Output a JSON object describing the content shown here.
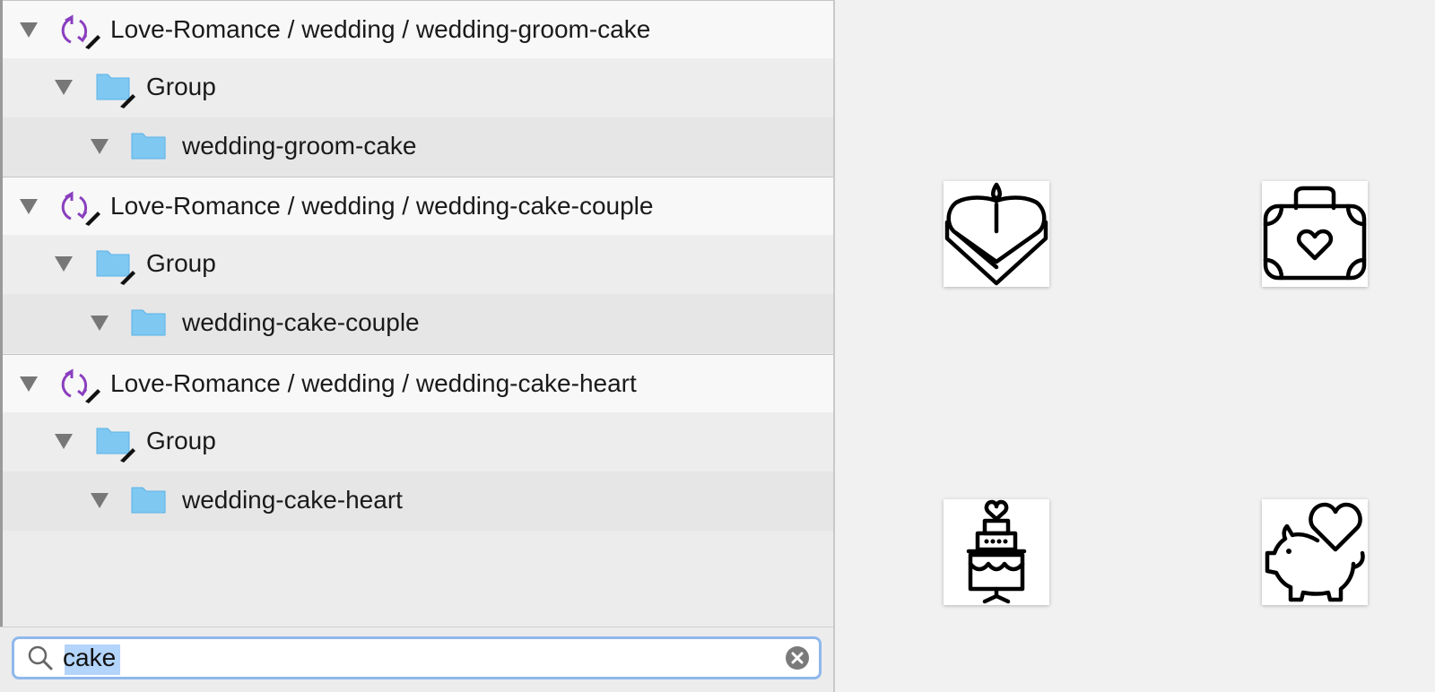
{
  "layers": [
    {
      "symbol_label": "Love-Romance / wedding / wedding-groom-cake",
      "group_label": "Group",
      "artboard_label": "wedding-groom-cake"
    },
    {
      "symbol_label": "Love-Romance / wedding / wedding-cake-couple",
      "group_label": "Group",
      "artboard_label": "wedding-cake-couple"
    },
    {
      "symbol_label": "Love-Romance / wedding / wedding-cake-heart",
      "group_label": "Group",
      "artboard_label": "wedding-cake-heart"
    }
  ],
  "search": {
    "value": "cake"
  },
  "icons": {
    "symbol": "symbol-sync-icon",
    "group": "folder-icon",
    "disclosure": "disclosure-triangle-icon",
    "search": "search-icon",
    "clear": "clear-icon"
  },
  "canvas_tiles": [
    "heart-cake-icon",
    "heart-suitcase-icon",
    "tiered-cake-icon",
    "piggy-bank-heart-icon"
  ],
  "colors": {
    "symbol_accent": "#8a3fbf",
    "folder": "#7fc8f2",
    "search_focus": "#8fb8ec",
    "selection": "#b3d4fb"
  }
}
